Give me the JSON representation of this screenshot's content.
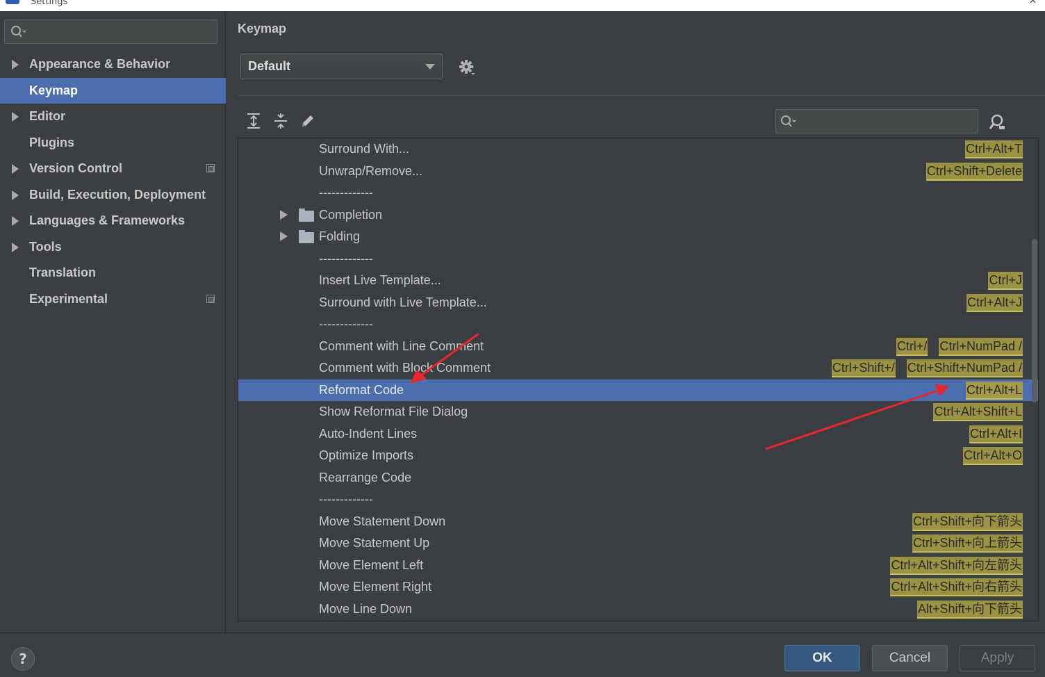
{
  "window": {
    "title": "Settings"
  },
  "sidebar": {
    "search_placeholder": "",
    "items": [
      {
        "label": "Appearance & Behavior",
        "expandable": true,
        "selected": false,
        "project_level": false
      },
      {
        "label": "Keymap",
        "expandable": false,
        "selected": true,
        "project_level": false
      },
      {
        "label": "Editor",
        "expandable": true,
        "selected": false,
        "project_level": false
      },
      {
        "label": "Plugins",
        "expandable": false,
        "selected": false,
        "project_level": false
      },
      {
        "label": "Version Control",
        "expandable": true,
        "selected": false,
        "project_level": true
      },
      {
        "label": "Build, Execution, Deployment",
        "expandable": true,
        "selected": false,
        "project_level": false
      },
      {
        "label": "Languages & Frameworks",
        "expandable": true,
        "selected": false,
        "project_level": false
      },
      {
        "label": "Tools",
        "expandable": true,
        "selected": false,
        "project_level": false
      },
      {
        "label": "Translation",
        "expandable": false,
        "selected": false,
        "project_level": false
      },
      {
        "label": "Experimental",
        "expandable": false,
        "selected": false,
        "project_level": true
      }
    ]
  },
  "main": {
    "title": "Keymap",
    "keymap_select": {
      "value": "Default"
    },
    "toolbar": {
      "expand_all": "expand-all-icon",
      "collapse_all": "collapse-all-icon",
      "edit": "pencil-icon",
      "find_shortcut": "find-by-shortcut-icon"
    },
    "search_placeholder": "",
    "rows": [
      {
        "label": "Surround With...",
        "type": "action",
        "shortcuts": [
          "Ctrl+Alt+T"
        ]
      },
      {
        "label": "Unwrap/Remove...",
        "type": "action",
        "shortcuts": [
          "Ctrl+Shift+Delete"
        ]
      },
      {
        "label": "-------------",
        "type": "separator",
        "shortcuts": []
      },
      {
        "label": "Completion",
        "type": "folder",
        "shortcuts": []
      },
      {
        "label": "Folding",
        "type": "folder",
        "shortcuts": []
      },
      {
        "label": "-------------",
        "type": "separator",
        "shortcuts": []
      },
      {
        "label": "Insert Live Template...",
        "type": "action",
        "shortcuts": [
          "Ctrl+J"
        ]
      },
      {
        "label": "Surround with Live Template...",
        "type": "action",
        "shortcuts": [
          "Ctrl+Alt+J"
        ]
      },
      {
        "label": "-------------",
        "type": "separator",
        "shortcuts": []
      },
      {
        "label": "Comment with Line Comment",
        "type": "action",
        "shortcuts": [
          "Ctrl+/",
          "Ctrl+NumPad /"
        ]
      },
      {
        "label": "Comment with Block Comment",
        "type": "action",
        "shortcuts": [
          "Ctrl+Shift+/",
          "Ctrl+Shift+NumPad /"
        ]
      },
      {
        "label": "Reformat Code",
        "type": "action",
        "selected": true,
        "shortcuts": [
          "Ctrl+Alt+L"
        ]
      },
      {
        "label": "Show Reformat File Dialog",
        "type": "action",
        "shortcuts": [
          "Ctrl+Alt+Shift+L"
        ]
      },
      {
        "label": "Auto-Indent Lines",
        "type": "action",
        "shortcuts": [
          "Ctrl+Alt+I"
        ]
      },
      {
        "label": "Optimize Imports",
        "type": "action",
        "shortcuts": [
          "Ctrl+Alt+O"
        ]
      },
      {
        "label": "Rearrange Code",
        "type": "action",
        "shortcuts": []
      },
      {
        "label": "-------------",
        "type": "separator",
        "shortcuts": []
      },
      {
        "label": "Move Statement Down",
        "type": "action",
        "shortcuts": [
          "Ctrl+Shift+向下箭头"
        ]
      },
      {
        "label": "Move Statement Up",
        "type": "action",
        "shortcuts": [
          "Ctrl+Shift+向上箭头"
        ]
      },
      {
        "label": "Move Element Left",
        "type": "action",
        "shortcuts": [
          "Ctrl+Alt+Shift+向左箭头"
        ]
      },
      {
        "label": "Move Element Right",
        "type": "action",
        "shortcuts": [
          "Ctrl+Alt+Shift+向右箭头"
        ]
      },
      {
        "label": "Move Line Down",
        "type": "action",
        "shortcuts": [
          "Alt+Shift+向下箭头"
        ]
      }
    ]
  },
  "footer": {
    "help": "?",
    "ok": "OK",
    "cancel": "Cancel",
    "apply": "Apply"
  },
  "colors": {
    "selection": "#4b6eaf",
    "shortcut_bg": "#9b9142",
    "annotation_arrow": "#e8262c"
  }
}
